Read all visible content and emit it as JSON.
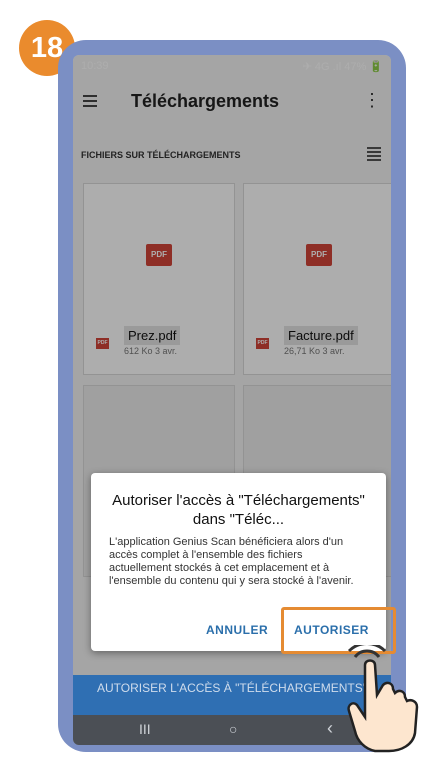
{
  "step_badge": "18",
  "status_bar": {
    "time": "10:39",
    "indicators": "✈ 4G .ıl 47% 🔋"
  },
  "app_bar": {
    "title": "Téléchargements"
  },
  "section_title": "FICHIERS SUR TÉLÉCHARGEMENTS",
  "files": [
    {
      "name": "Prez.pdf",
      "meta": "612 Ko 3 avr.",
      "icon": "PDF"
    },
    {
      "name": "Facture.pdf",
      "meta": "26,71 Ko 3 avr.",
      "icon": "PDF"
    }
  ],
  "dialog": {
    "title": "Autoriser l'accès à \"Téléchargements\" dans \"Téléc...",
    "body": "L'application Genius Scan bénéficiera alors d'un accès complet à l'ensemble des fichiers actuellement stockés à cet emplacement et à l'ensemble du contenu qui y sera stocké à l'avenir.",
    "cancel_label": "ANNULER",
    "allow_label": "AUTORISER"
  },
  "bottom_button": {
    "label": "AUTORISER L'ACCÈS À \"TÉLÉCHARGEMENTS\""
  },
  "navbar": {
    "recent": "III",
    "home": "○",
    "back": "‹"
  },
  "colors": {
    "accent": "#2b6fab",
    "badge": "#ea8b2d",
    "pdf": "#d24438",
    "highlight": "#e58b32"
  }
}
